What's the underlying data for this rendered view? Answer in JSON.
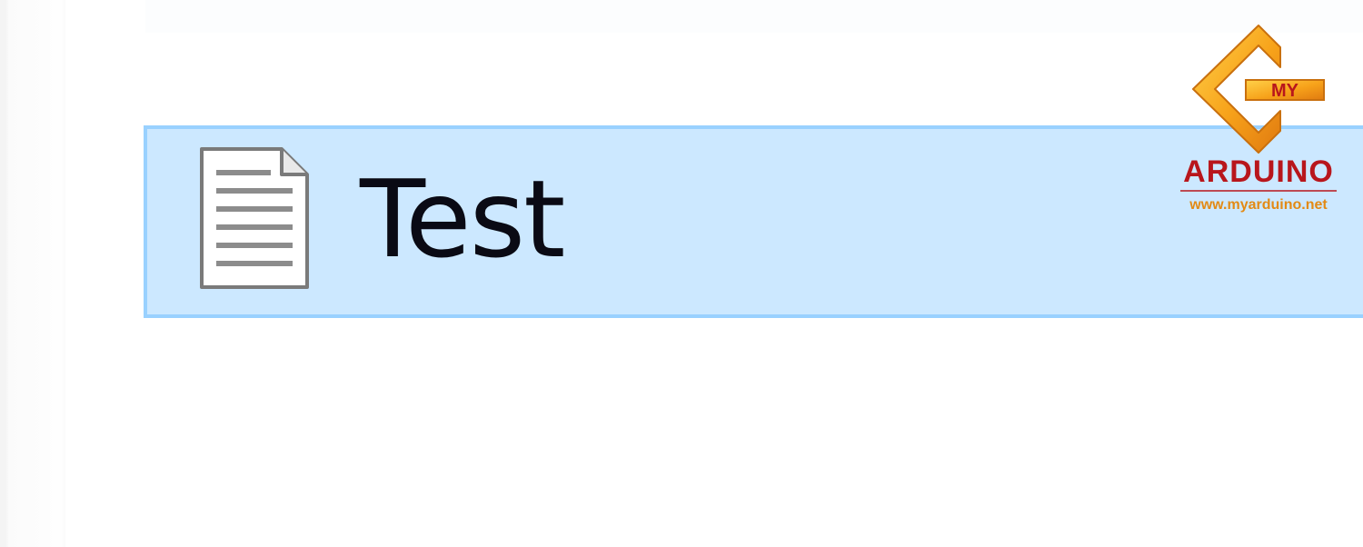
{
  "file_list": {
    "items": [
      {
        "name": "Test",
        "selected": true,
        "icon": "document-icon"
      }
    ]
  },
  "colors": {
    "selection_fill": "#cce8ff",
    "selection_border": "#99d1ff"
  },
  "watermark": {
    "brand_small": "MY",
    "brand_large": "ARDUINO",
    "url": "www.myarduino.net"
  }
}
